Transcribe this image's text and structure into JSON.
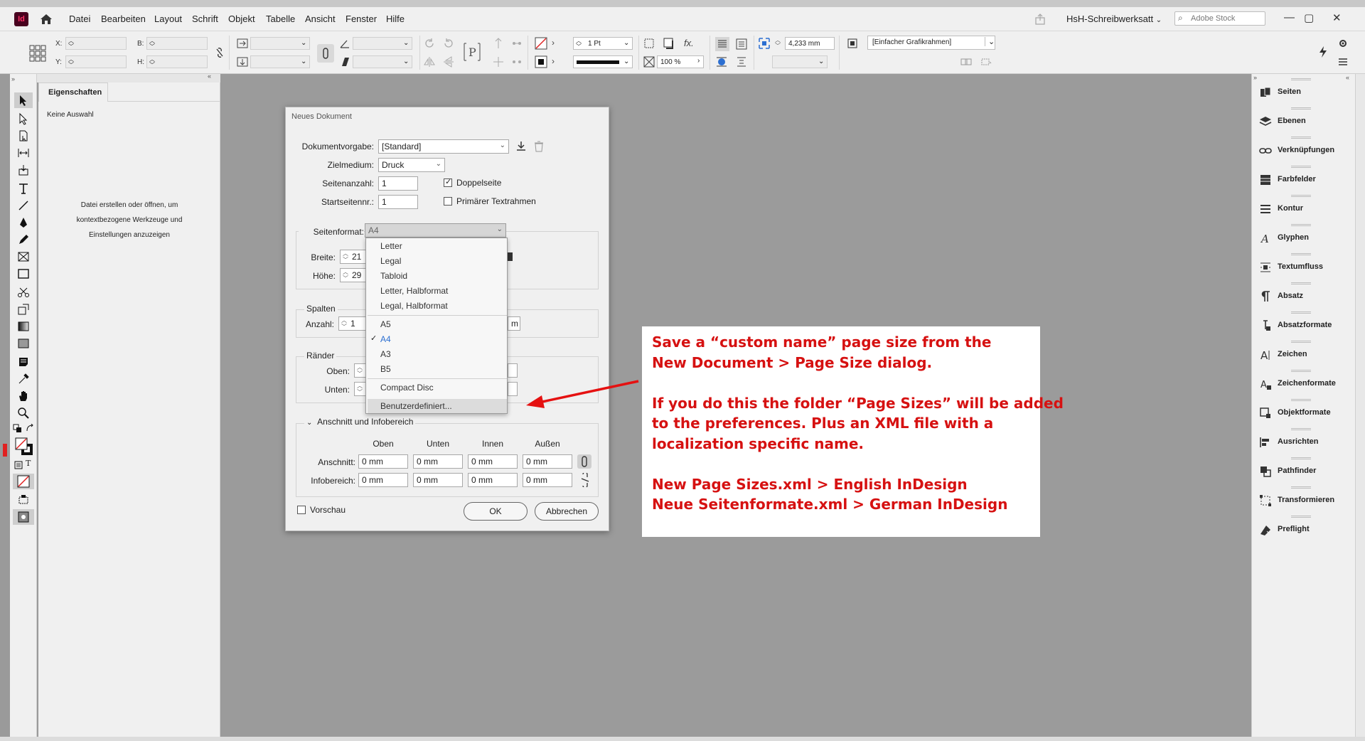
{
  "menubar": {
    "app_logo": "Id",
    "items": [
      "Datei",
      "Bearbeiten",
      "Layout",
      "Schrift",
      "Objekt",
      "Tabelle",
      "Ansicht",
      "Fenster",
      "Hilfe"
    ],
    "workspace": "HsH-Schreibwerksatt",
    "stock_placeholder": "Adobe Stock",
    "window_controls": [
      "—",
      "▢",
      "✕"
    ]
  },
  "controlbar": {
    "x_label": "X:",
    "y_label": "Y:",
    "b_label": "B:",
    "h_label": "H:",
    "stroke_weight": "1 Pt",
    "offset_value": "4,233 mm",
    "opacity": "100 %",
    "frame_style": "[Einfacher Grafikrahmen]"
  },
  "props": {
    "tab": "Eigenschaften",
    "no_selection": "Keine Auswahl",
    "hint_lines": [
      "Datei erstellen oder öffnen, um",
      "kontextbezogene Werkzeuge und",
      "Einstellungen anzuzeigen"
    ]
  },
  "rightpanel": {
    "items": [
      "Seiten",
      "Ebenen",
      "Verknüpfungen",
      "Farbfelder",
      "Kontur",
      "Glyphen",
      "Textumfluss",
      "Absatz",
      "Absatzformate",
      "Zeichen",
      "Zeichenformate",
      "Objektformate",
      "Ausrichten",
      "Pathfinder",
      "Transformieren",
      "Preflight"
    ]
  },
  "dialog": {
    "title": "Neues Dokument",
    "preset_label": "Dokumentvorgabe:",
    "preset_value": "[Standard]",
    "intent_label": "Zielmedium:",
    "intent_value": "Druck",
    "pages_label": "Seitenanzahl:",
    "pages_value": "1",
    "start_label": "Startseitennr.:",
    "start_value": "1",
    "facing_label": "Doppelseite",
    "facing_checked": true,
    "primary_label": "Primärer Textrahmen",
    "primary_checked": false,
    "pagesize_label": "Seitenformat:",
    "pagesize_value": "A4",
    "width_label": "Breite:",
    "width_value": "21",
    "height_label": "Höhe:",
    "height_value": "29",
    "columns_title": "Spalten",
    "columns_count_label": "Anzahl:",
    "columns_count_value": "1",
    "columns_gutter_partial": "m",
    "margins_title": "Ränder",
    "top_label": "Oben:",
    "bottom_label": "Unten:",
    "bleed_title": "Anschnitt und Infobereich",
    "bleed_cols": [
      "Oben",
      "Unten",
      "Innen",
      "Außen"
    ],
    "bleed_label": "Anschnitt:",
    "bleed_values": [
      "0 mm",
      "0 mm",
      "0 mm",
      "0 mm"
    ],
    "slug_label": "Infobereich:",
    "slug_values": [
      "0 mm",
      "0 mm",
      "0 mm",
      "0 mm"
    ],
    "preview_label": "Vorschau",
    "ok_label": "OK",
    "cancel_label": "Abbrechen"
  },
  "dropdown": {
    "group1": [
      "Letter",
      "Legal",
      "Tabloid",
      "Letter, Halbformat",
      "Legal, Halbformat"
    ],
    "group2": [
      "A5",
      "A4",
      "A3",
      "B5"
    ],
    "selected": "A4",
    "group3": [
      "Compact Disc"
    ],
    "custom": "Benutzerdefiniert..."
  },
  "annotation": {
    "lines": [
      "Save a “custom name” page size from the",
      "New Document > Page Size dialog.",
      "",
      "If you do this the folder “Page Sizes” will be added",
      "to the preferences. Plus an XML file with a",
      "localization specific name.",
      "",
      "New Page Sizes.xml > English InDesign",
      "Neue Seitenformate.xml > German InDesign"
    ],
    "color": "#d61111"
  }
}
